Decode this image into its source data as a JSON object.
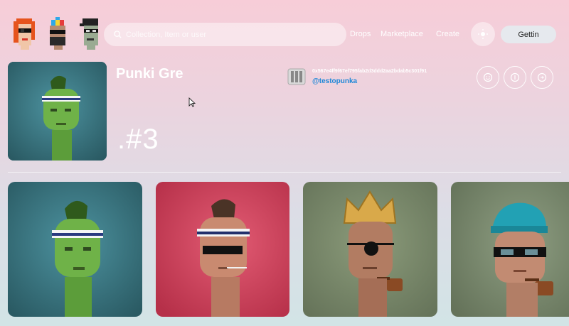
{
  "header": {
    "logos": [
      {
        "icon": "punk-red-hair-icon"
      },
      {
        "icon": "punk-propeller-cap-icon"
      },
      {
        "icon": "punk-cap-glasses-icon"
      }
    ],
    "search": {
      "placeholder": "Collection, Item or user",
      "icon": "search-icon"
    },
    "nav": [
      "Drops",
      "Marketplace",
      "Create"
    ],
    "theme_icon": "sun-icon",
    "cta_label": "Gettin"
  },
  "profile": {
    "title": "Punki Gre",
    "token": ".#3",
    "owner": {
      "address": "0x567e4ff9f67ef795fab2d3ddd2aa2bdab5c301f91",
      "handle": "@testopunka"
    },
    "actions": [
      {
        "icon": "smile-icon"
      },
      {
        "icon": "currency-icon"
      },
      {
        "icon": "share-icon"
      }
    ]
  },
  "gallery": [
    {
      "name": "green-punk",
      "bg": "#3f7f8a",
      "skin": "#6fb248"
    },
    {
      "name": "pink-punk",
      "bg": "#d94a63",
      "skin": "#c98a70"
    },
    {
      "name": "crown-punk",
      "bg": "#7d8e6c",
      "skin": "#b27c62"
    },
    {
      "name": "beanie-punk",
      "bg": "#7f8f74",
      "skin": "#c28b72"
    }
  ],
  "colors": {
    "accent": "#1e88d8",
    "card_teal": "#3f7f8a",
    "card_pink": "#d94a63"
  }
}
